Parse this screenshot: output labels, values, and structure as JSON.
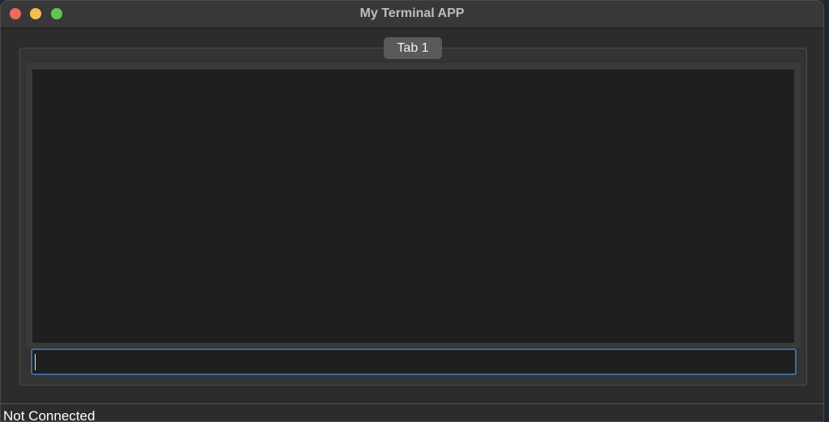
{
  "window": {
    "title": "My Terminal APP",
    "controls": [
      "close",
      "minimize",
      "maximize"
    ]
  },
  "tabs": [
    {
      "label": "Tab 1",
      "selected": true
    }
  ],
  "terminal": {
    "output_text": "",
    "input_value": "",
    "input_placeholder": ""
  },
  "status": {
    "text": "Not Connected"
  },
  "colors": {
    "close": "#ed6a5e",
    "minimize": "#f5bf4f",
    "maximize": "#61c554",
    "input_focus_border": "#3d6a9e"
  }
}
